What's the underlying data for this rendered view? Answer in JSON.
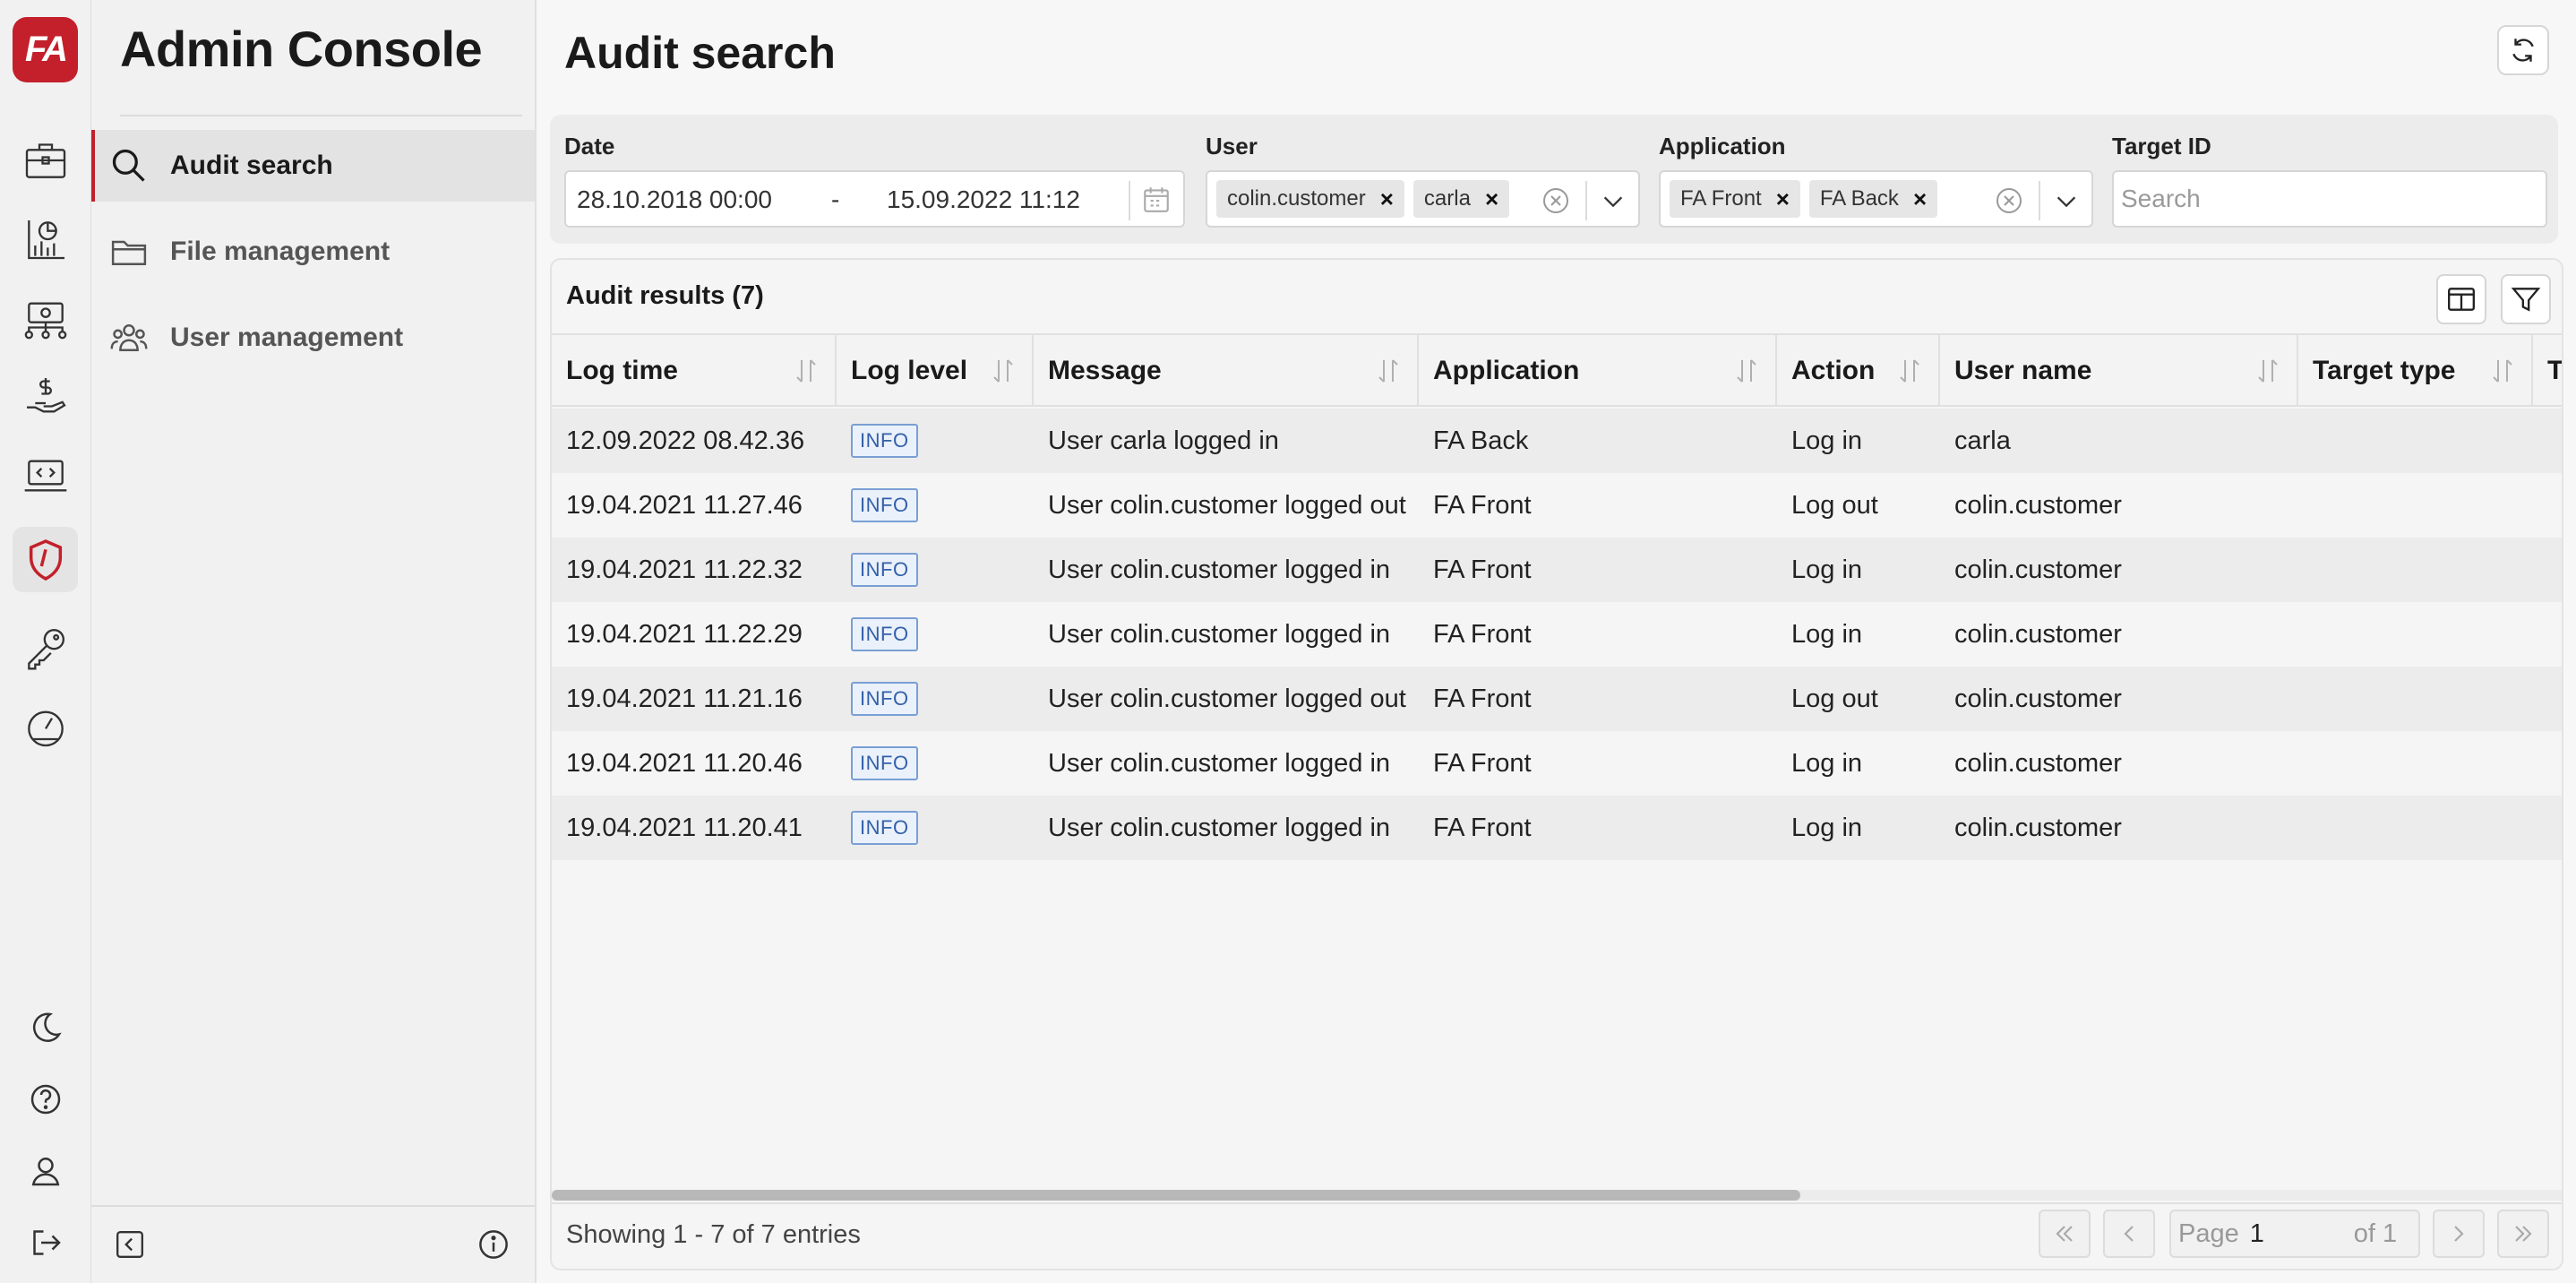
{
  "app": {
    "logo_text": "FA",
    "title": "Admin Console",
    "brand_color": "#c3202b"
  },
  "nav": {
    "items": [
      {
        "label": "Audit search",
        "icon": "search-icon",
        "active": true
      },
      {
        "label": "File management",
        "icon": "folder-icon",
        "active": false
      },
      {
        "label": "User management",
        "icon": "users-icon",
        "active": false
      }
    ]
  },
  "rail": {
    "icons": [
      "briefcase-icon",
      "chart-icon",
      "money-network-icon",
      "hand-dollar-icon",
      "code-monitor-icon",
      "shield-icon",
      "key-icon",
      "gauge-icon"
    ],
    "bottom_icons": [
      "moon-icon",
      "help-icon",
      "user-icon",
      "logout-icon"
    ]
  },
  "page": {
    "title": "Audit search"
  },
  "filters": {
    "date": {
      "label": "Date",
      "from": "28.10.2018 00:00",
      "separator": "-",
      "to": "15.09.2022 11:12"
    },
    "user": {
      "label": "User",
      "chips": [
        "colin.customer",
        "carla"
      ]
    },
    "application": {
      "label": "Application",
      "chips": [
        "FA Front",
        "FA Back"
      ]
    },
    "target_id": {
      "label": "Target ID",
      "placeholder": "Search"
    }
  },
  "results": {
    "title": "Audit results (7)",
    "columns": [
      "Log time",
      "Log level",
      "Message",
      "Application",
      "Action",
      "User name",
      "Target type",
      "T"
    ],
    "rows": [
      [
        "12.09.2022 08.42.36",
        "INFO",
        "User carla logged in",
        "FA Back",
        "Log in",
        "carla"
      ],
      [
        "19.04.2021 11.27.46",
        "INFO",
        "User colin.customer logged out",
        "FA Front",
        "Log out",
        "colin.customer"
      ],
      [
        "19.04.2021 11.22.32",
        "INFO",
        "User colin.customer logged in",
        "FA Front",
        "Log in",
        "colin.customer"
      ],
      [
        "19.04.2021 11.22.29",
        "INFO",
        "User colin.customer logged in",
        "FA Front",
        "Log in",
        "colin.customer"
      ],
      [
        "19.04.2021 11.21.16",
        "INFO",
        "User colin.customer logged out",
        "FA Front",
        "Log out",
        "colin.customer"
      ],
      [
        "19.04.2021 11.20.46",
        "INFO",
        "User colin.customer logged in",
        "FA Front",
        "Log in",
        "colin.customer"
      ],
      [
        "19.04.2021 11.20.41",
        "INFO",
        "User colin.customer logged in",
        "FA Front",
        "Log in",
        "colin.customer"
      ]
    ],
    "showing": "Showing 1 - 7 of 7 entries",
    "pagination": {
      "page_label": "Page",
      "page": "1",
      "of_label": "of 1"
    }
  }
}
